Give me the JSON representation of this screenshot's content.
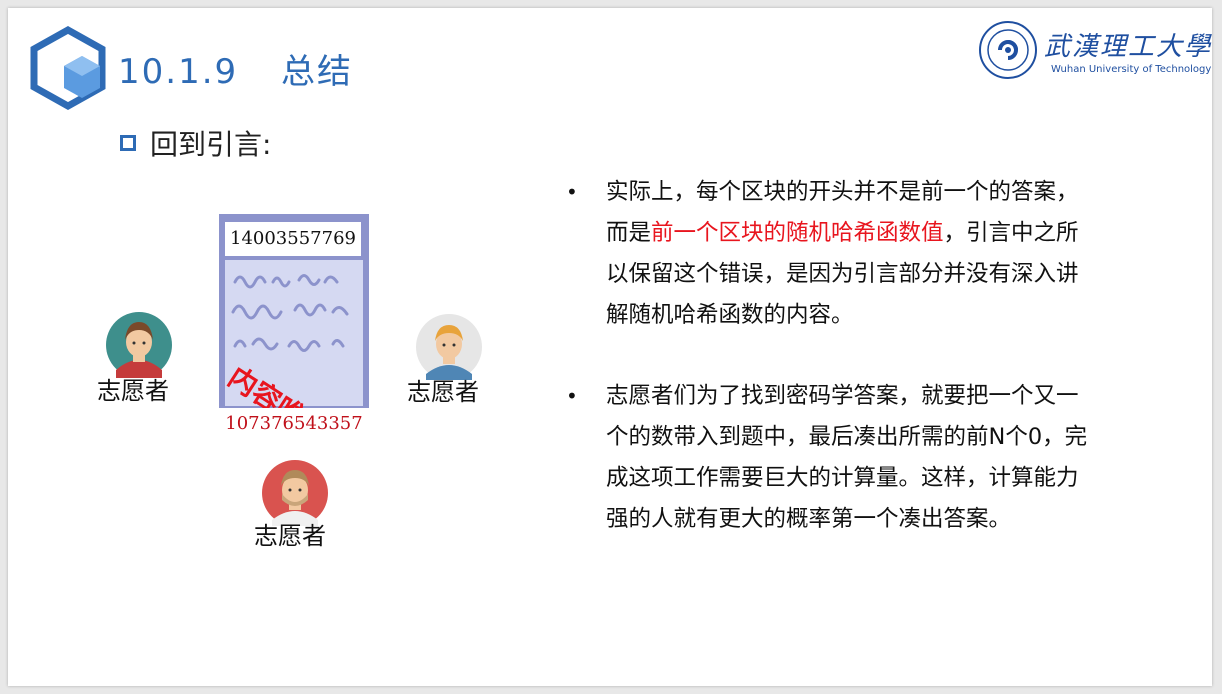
{
  "header": {
    "section_number": "10.1.9",
    "title": "总结",
    "university_cn": "武漢理工大學",
    "university_en": "Wuhan University of Technology"
  },
  "subheading": "回到引言:",
  "diagram": {
    "card_top_number": "14003557769",
    "card_bottom_number": "107376543357",
    "stamp_text": "内容唯一",
    "volunteers": [
      "志愿者",
      "志愿者",
      "志愿者"
    ]
  },
  "bullets": [
    {
      "before": "实际上，每个区块的开头并不是前一个的答案，而是",
      "highlight": "前一个区块的随机哈希函数值",
      "after": "，引言中之所以保留这个错误，是因为引言部分并没有深入讲解随机哈希函数的内容。"
    },
    {
      "before": "志愿者们为了找到密码学答案，就要把一个又一个的数带入到题中，最后凑出所需的前N个0，完成这项工作需要巨大的计算量。这样，计算能力强的人就有更大的概率第一个凑出答案。",
      "highlight": "",
      "after": ""
    }
  ],
  "colors": {
    "title_blue": "#2e6bb5",
    "highlight_red": "#e8151e",
    "card_purple": "#8c93cc"
  }
}
